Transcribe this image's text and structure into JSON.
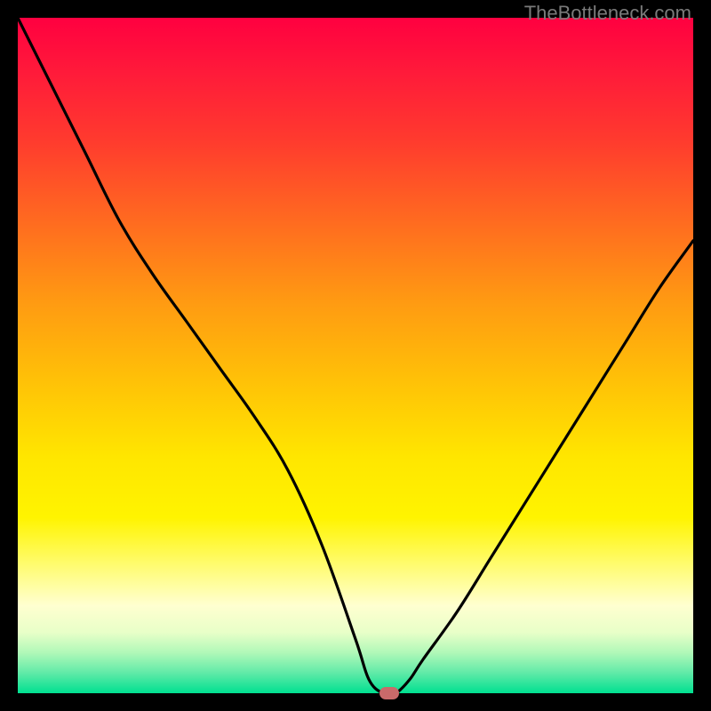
{
  "watermark": "TheBottleneck.com",
  "chart_data": {
    "type": "line",
    "title": "",
    "xlabel": "",
    "ylabel": "",
    "xlim": [
      0,
      100
    ],
    "ylim": [
      0,
      100
    ],
    "x": [
      0,
      5,
      10,
      15,
      20,
      25,
      30,
      35,
      40,
      45,
      50,
      52,
      54,
      55,
      56,
      58,
      60,
      65,
      70,
      75,
      80,
      85,
      90,
      95,
      100
    ],
    "values": [
      100,
      90,
      80,
      70,
      62,
      55,
      48,
      41,
      33,
      22,
      8,
      2,
      0,
      0,
      0,
      2,
      5,
      12,
      20,
      28,
      36,
      44,
      52,
      60,
      67
    ],
    "minimum_at_x": 55,
    "minimum_value": 0,
    "background_gradient": {
      "top": "#ff0040",
      "mid": "#ffe600",
      "bottom": "#00e090"
    },
    "marker": {
      "x": 55,
      "y": 0
    }
  }
}
